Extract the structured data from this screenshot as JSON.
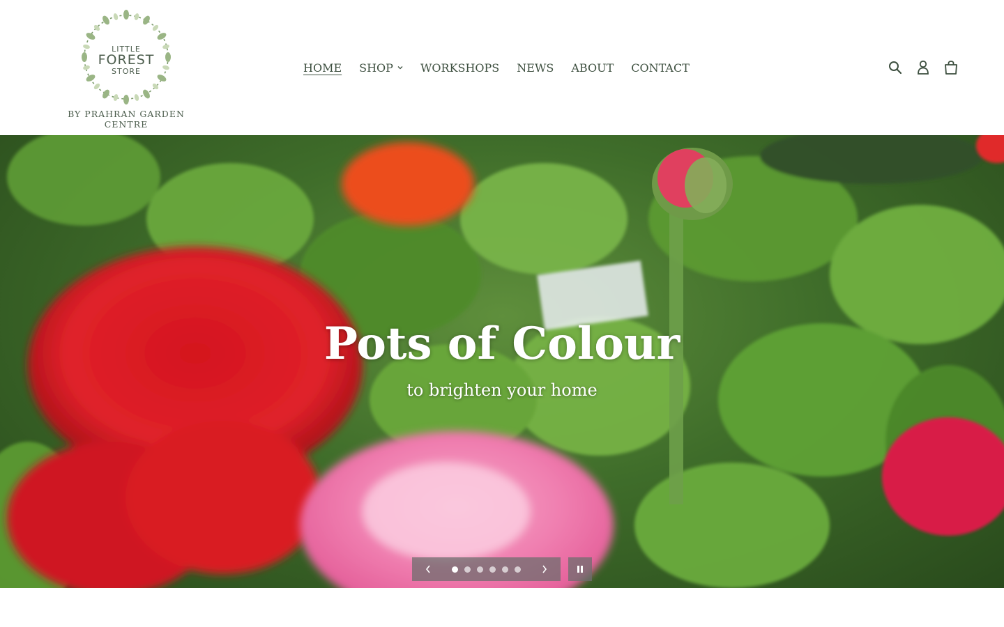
{
  "brand": {
    "logo_line1": "LITTLE",
    "logo_line2": "FOREST",
    "logo_line3": "STORE",
    "tagline": "BY PRAHRAN GARDEN CENTRE"
  },
  "nav": {
    "items": [
      {
        "label": "HOME",
        "active": true
      },
      {
        "label": "SHOP",
        "dropdown": true
      },
      {
        "label": "WORKSHOPS"
      },
      {
        "label": "NEWS"
      },
      {
        "label": "ABOUT"
      },
      {
        "label": "CONTACT"
      }
    ]
  },
  "header_icons": [
    "search-icon",
    "account-icon",
    "cart-icon"
  ],
  "hero": {
    "title": "Pots of Colour",
    "subtitle": "to brighten your home",
    "slides_total": 6,
    "current_slide": 1
  },
  "colors": {
    "text": "#3d4f3f",
    "hero_text": "#ffffff",
    "control_bg": "#6e6e6e"
  }
}
